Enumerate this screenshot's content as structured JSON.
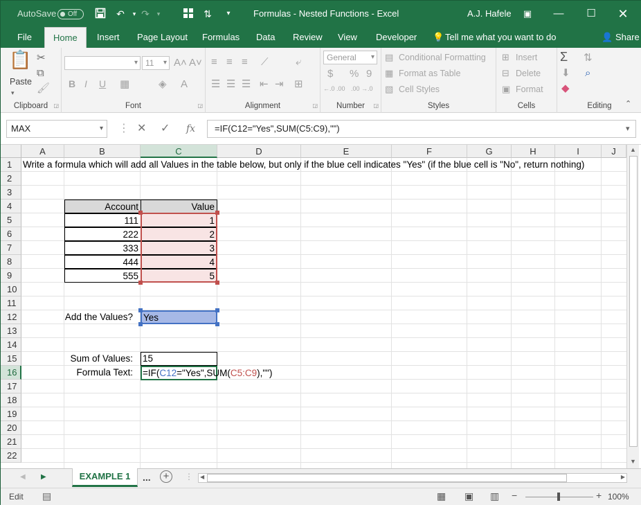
{
  "title_bar": {
    "autosave_label": "AutoSave",
    "autosave_state": "Off",
    "document_title": "Formulas - Nested Functions  -  Excel",
    "user_name": "A.J. Hafele"
  },
  "tabs": [
    "File",
    "Home",
    "Insert",
    "Page Layout",
    "Formulas",
    "Data",
    "Review",
    "View",
    "Developer"
  ],
  "tell_me": "Tell me what you want to do",
  "share": "Share",
  "ribbon": {
    "clipboard": {
      "label": "Clipboard",
      "paste": "Paste"
    },
    "font": {
      "label": "Font",
      "font_size": "11",
      "bold": "B",
      "italic": "I",
      "underline": "U"
    },
    "alignment": {
      "label": "Alignment"
    },
    "number": {
      "label": "Number",
      "format": "General",
      "currency": "$",
      "percent": "%",
      "comma": "9",
      "dec_inc": "←.0 .00",
      "dec_dec": ".00 →.0"
    },
    "styles": {
      "label": "Styles",
      "conditional": "Conditional Formatting",
      "format_table": "Format as Table",
      "cell_styles": "Cell Styles"
    },
    "cells": {
      "label": "Cells",
      "insert": "Insert",
      "delete": "Delete",
      "format": "Format"
    },
    "editing": {
      "label": "Editing"
    }
  },
  "formula_bar": {
    "name_box": "MAX",
    "fx": "fx",
    "formula": "=IF(C12=\"Yes\",SUM(C5:C9),\"\")"
  },
  "columns": [
    "A",
    "B",
    "C",
    "D",
    "E",
    "F",
    "G",
    "H",
    "I",
    "J"
  ],
  "rows": [
    "1",
    "2",
    "3",
    "4",
    "5",
    "6",
    "7",
    "8",
    "9",
    "10",
    "11",
    "12",
    "13",
    "14",
    "15",
    "16",
    "17",
    "18",
    "19",
    "20",
    "21",
    "22"
  ],
  "sheet": {
    "instruction": "Write a formula which will add all Values in the table below, but only if the blue cell indicates \"Yes\" (if the blue cell is \"No\", return nothing)",
    "table_headers": {
      "account": "Account",
      "value": "Value"
    },
    "table_rows": [
      {
        "account": "111",
        "value": "1"
      },
      {
        "account": "222",
        "value": "2"
      },
      {
        "account": "333",
        "value": "3"
      },
      {
        "account": "444",
        "value": "4"
      },
      {
        "account": "555",
        "value": "5"
      }
    ],
    "add_values_label": "Add the Values?",
    "add_values": "Yes",
    "sum_label": "Sum of Values:",
    "sum_value": "15",
    "formula_text_label": "Formula Text:",
    "formula_parts": {
      "p1": "=IF(",
      "p2": "C12",
      "p3": "=\"Yes\",SUM(",
      "p4": "C5:C9",
      "p5": "),\"\")"
    }
  },
  "sheet_tabs": {
    "active": "EXAMPLE 1",
    "more": "..."
  },
  "status_bar": {
    "mode": "Edit",
    "zoom": "100%"
  },
  "colors": {
    "accent": "#217346",
    "blue_ref": "#4472c4",
    "red_ref": "#c0504d",
    "yes_fill": "#a6b8e6",
    "value_fill": "#f8e4e4"
  }
}
